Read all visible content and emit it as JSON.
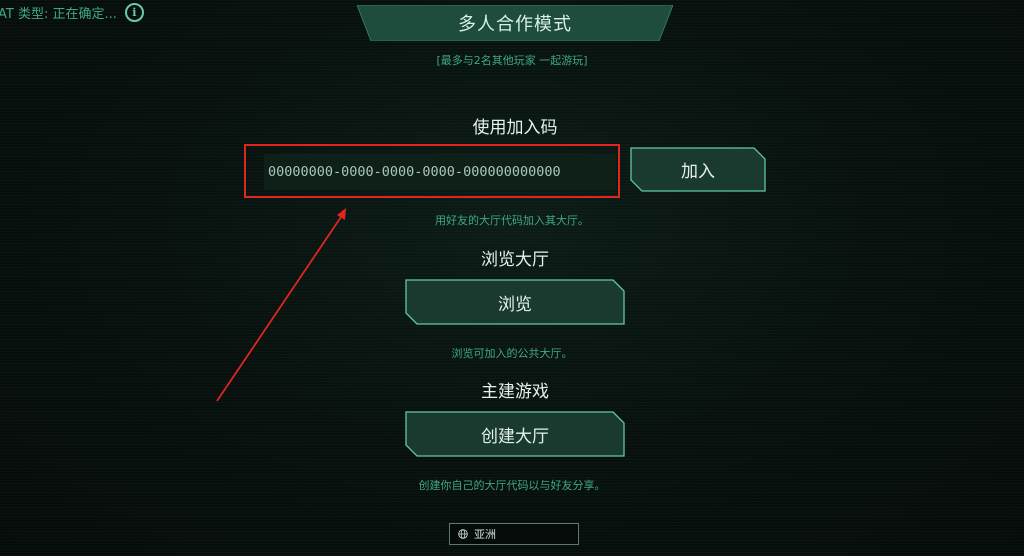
{
  "header": {
    "nat_status": "AT 类型: 正在确定...",
    "title": "多人合作模式",
    "subtitle": "[最多与2名其他玩家 一起游玩]"
  },
  "join_section": {
    "heading": "使用加入码",
    "input_value": "00000000-0000-0000-0000-000000000000",
    "button_label": "加入",
    "hint": "用好友的大厅代码加入其大厅。"
  },
  "browse_section": {
    "heading": "浏览大厅",
    "button_label": "浏览",
    "hint": "浏览可加入的公共大厅。"
  },
  "host_section": {
    "heading": "主建游戏",
    "button_label": "创建大厅",
    "hint": "创建你自己的大厅代码以与好友分享。"
  },
  "region": {
    "label": "亚洲",
    "icon": "globe-icon"
  },
  "colors": {
    "accent": "#3fa884",
    "button_fill": "#1b3a2f",
    "button_border": "#5fc9a0",
    "highlight": "#e0251f"
  }
}
